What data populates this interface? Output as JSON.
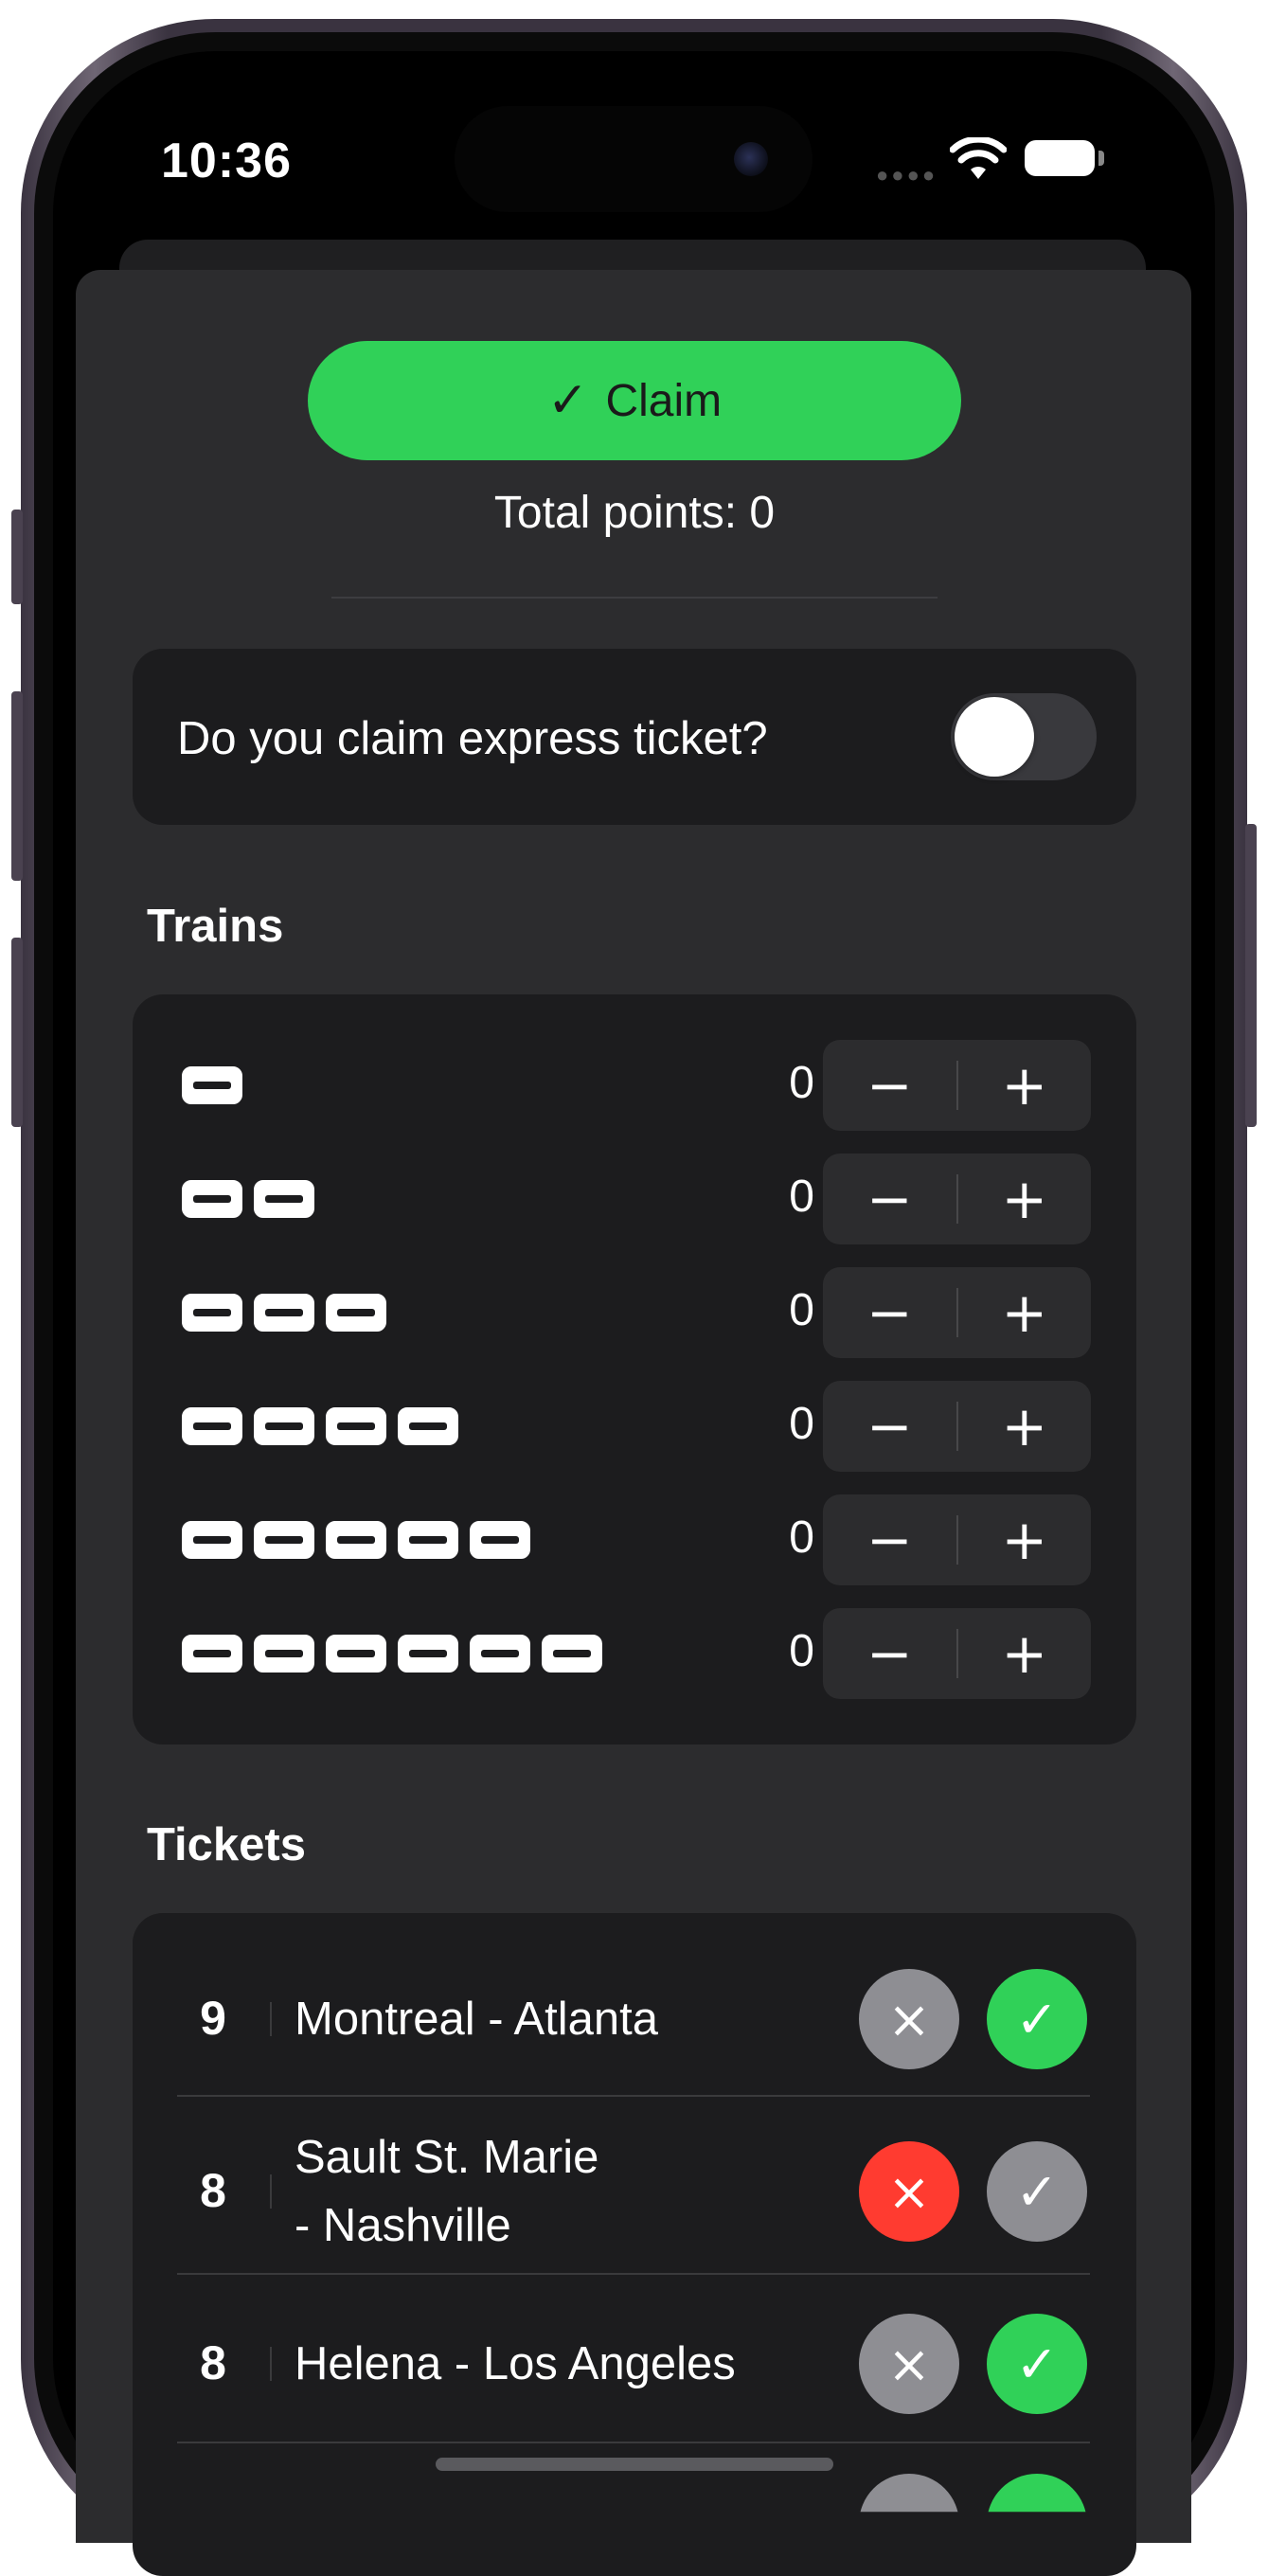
{
  "status_bar": {
    "time": "10:36",
    "wifi_icon": "wifi-icon",
    "battery_icon": "battery-icon"
  },
  "claim": {
    "icon": "checkmark",
    "label": "Claim",
    "color": "#30d158"
  },
  "total_points": "Total points: 0",
  "express": {
    "label": "Do you claim express ticket?",
    "enabled": false
  },
  "trains": {
    "title": "Trains",
    "rows": [
      {
        "length": 1,
        "count": "0"
      },
      {
        "length": 2,
        "count": "0"
      },
      {
        "length": 3,
        "count": "0"
      },
      {
        "length": 4,
        "count": "0"
      },
      {
        "length": 5,
        "count": "0"
      },
      {
        "length": 6,
        "count": "0"
      }
    ],
    "minus": "−",
    "plus": "+"
  },
  "tickets": {
    "title": "Tickets",
    "items": [
      {
        "points": "9",
        "route": "Montreal - Atlanta",
        "route_line2": "",
        "status": "completed"
      },
      {
        "points": "8",
        "route": "Sault St. Marie",
        "route_line2": "- Nashville",
        "status": "failed"
      },
      {
        "points": "8",
        "route": "Helena - Los Angeles",
        "route_line2": "",
        "status": "completed"
      }
    ],
    "reject_icon": "×",
    "accept_icon": "✓"
  },
  "colors": {
    "accent_green": "#30d158",
    "fail_red": "#ff3b30",
    "inactive_gray": "#8e8e93",
    "sheet_bg": "#2c2c2e",
    "card_bg": "#1c1c1e"
  }
}
